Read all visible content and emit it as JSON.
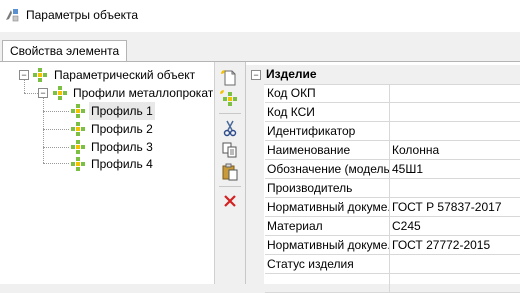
{
  "window": {
    "title": "Параметры объекта",
    "icon": "object-parameters-icon"
  },
  "tabs": [
    {
      "label": "Свойства элемента",
      "active": true
    }
  ],
  "tree": {
    "root": {
      "label": "Параметрический объект",
      "icon": "object-node-icon",
      "expanded": true
    },
    "group": {
      "label": "Профили металлопрокат",
      "icon": "object-node-icon",
      "expanded": true
    },
    "items": [
      {
        "label": "Профиль 1",
        "selected": true
      },
      {
        "label": "Профиль 2",
        "selected": false
      },
      {
        "label": "Профиль 3",
        "selected": false
      },
      {
        "label": "Профиль 4",
        "selected": false
      }
    ]
  },
  "toolbar": {
    "buttons": [
      "new-document-icon",
      "add-object-icon",
      "cut-icon",
      "copy-icon",
      "paste-icon",
      "delete-icon"
    ]
  },
  "properties": {
    "category": "Изделие",
    "rows": [
      {
        "name": "Код ОКП",
        "value": ""
      },
      {
        "name": "Код КСИ",
        "value": ""
      },
      {
        "name": "Идентификатор",
        "value": ""
      },
      {
        "name": "Наименование",
        "value": "Колонна"
      },
      {
        "name": "Обозначение (модель)",
        "value": "45Ш1"
      },
      {
        "name": "Производитель",
        "value": ""
      },
      {
        "name": "Нормативный докуме...",
        "value": "ГОСТ Р 57837-2017"
      },
      {
        "name": "Материал",
        "value": "С245"
      },
      {
        "name": "Нормативный докуме...",
        "value": "ГОСТ 27772-2015"
      },
      {
        "name": "Статус изделия",
        "value": ""
      },
      {
        "name": "",
        "value": ""
      }
    ]
  },
  "colors": {
    "node_green": "#7cc043",
    "node_yellow": "#f2c200",
    "delete_red": "#d42020"
  }
}
